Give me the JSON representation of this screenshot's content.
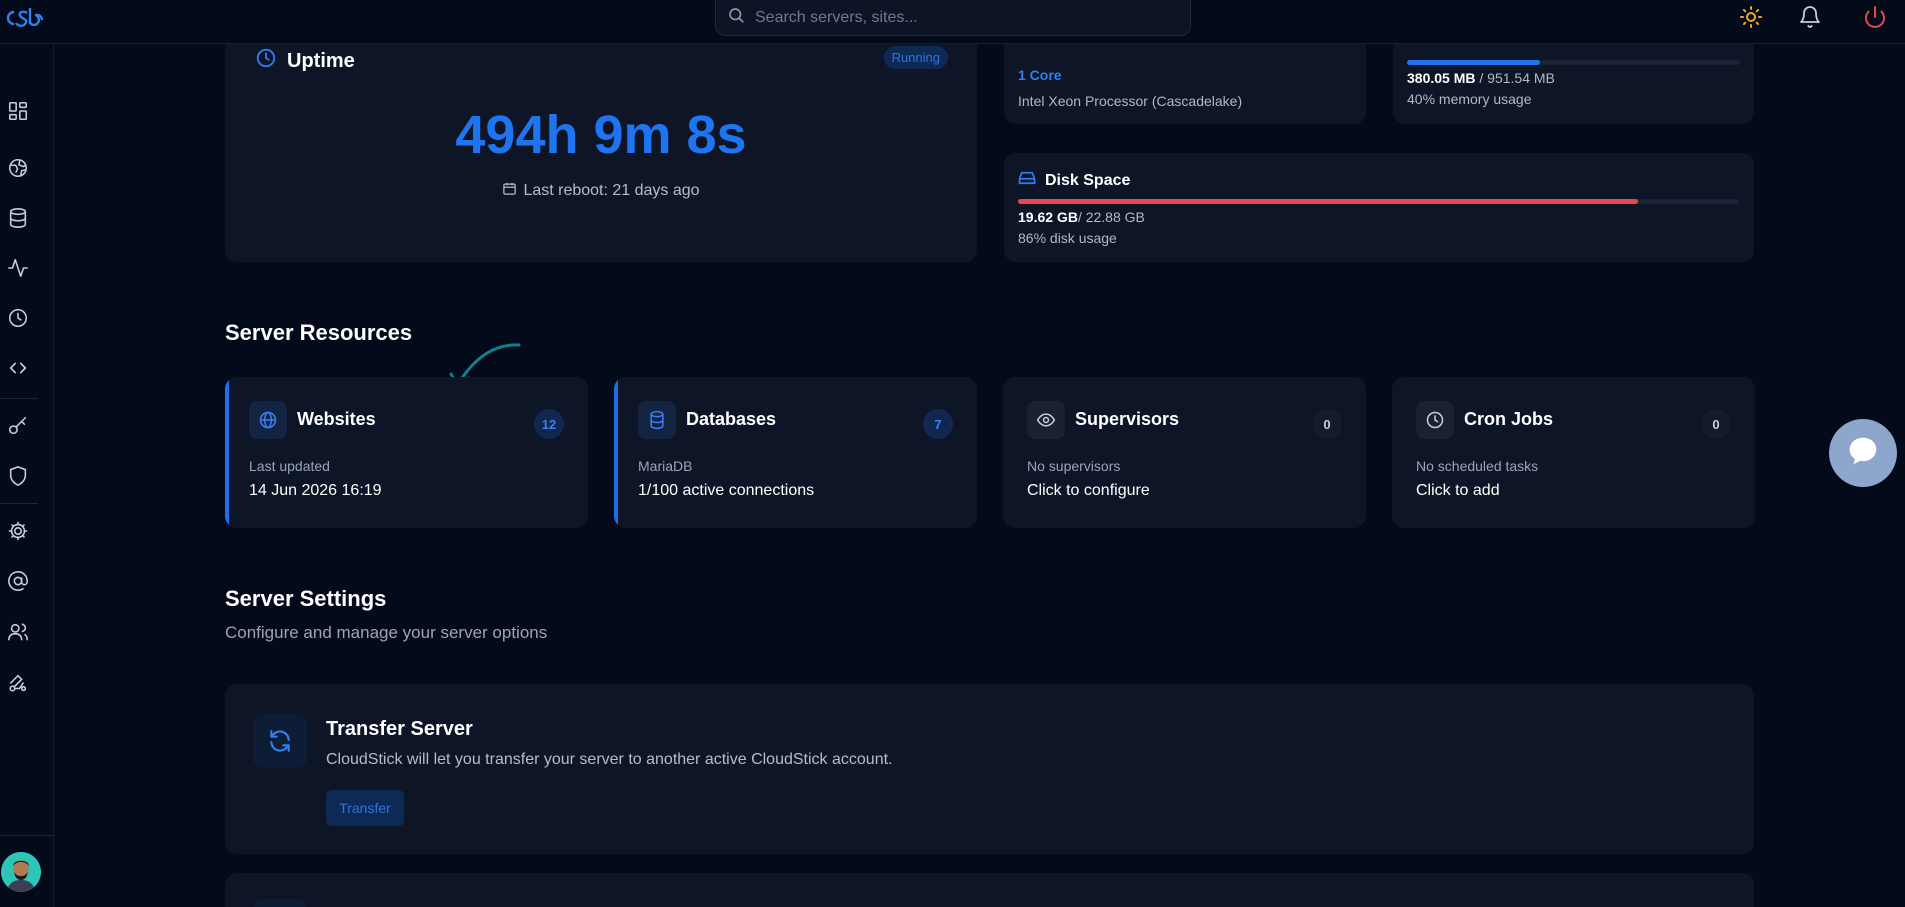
{
  "search": {
    "placeholder": "Search servers, sites..."
  },
  "colors": {
    "accent": "#1f74f0",
    "danger": "#e5484d",
    "sun": "#f5a524",
    "background": "#030a1a",
    "card": "#0d1527"
  },
  "icons": {
    "topbar": [
      "logo",
      "search-icon",
      "sun-icon",
      "bell-icon",
      "power-icon"
    ],
    "sidebar": [
      "dashboard-icon",
      "globe-icon",
      "database-icon",
      "activity-icon",
      "clock-icon",
      "code-icon",
      "key-icon",
      "shield-icon",
      "settings-icon",
      "at-sign-icon",
      "users-icon",
      "route-icon"
    ]
  },
  "uptime": {
    "title": "Uptime",
    "status": "Running",
    "value": "494h 9m 8s",
    "last_reboot": "Last reboot: 21 days ago"
  },
  "cpu": {
    "cores": "1 Core",
    "processor": "Intel Xeon Processor (Cascadelake)"
  },
  "memory": {
    "used": "380.05 MB",
    "total": "/ 951.54 MB",
    "usage_text": "40% memory usage",
    "usage_fraction": 0.4
  },
  "disk": {
    "title": "Disk Space",
    "used": "19.62 GB",
    "total": "/ 22.88 GB",
    "usage_text": "86% disk usage",
    "usage_fraction": 0.86
  },
  "server_resources": {
    "title": "Server Resources",
    "cards": [
      {
        "name": "Websites",
        "count": "12",
        "label": "Last updated",
        "value": "14 Jun 2026 16:19"
      },
      {
        "name": "Databases",
        "count": "7",
        "label": "MariaDB",
        "value": "1/100 active connections"
      },
      {
        "name": "Supervisors",
        "count": "0",
        "label": "No supervisors",
        "value": "Click to configure"
      },
      {
        "name": "Cron Jobs",
        "count": "0",
        "label": "No scheduled tasks",
        "value": "Click to add"
      }
    ]
  },
  "server_settings": {
    "title": "Server Settings",
    "subtitle": "Configure and manage your server options",
    "transfer": {
      "title": "Transfer Server",
      "description": "CloudStick will let you transfer your server to another active CloudStick account.",
      "button": "Transfer"
    }
  }
}
